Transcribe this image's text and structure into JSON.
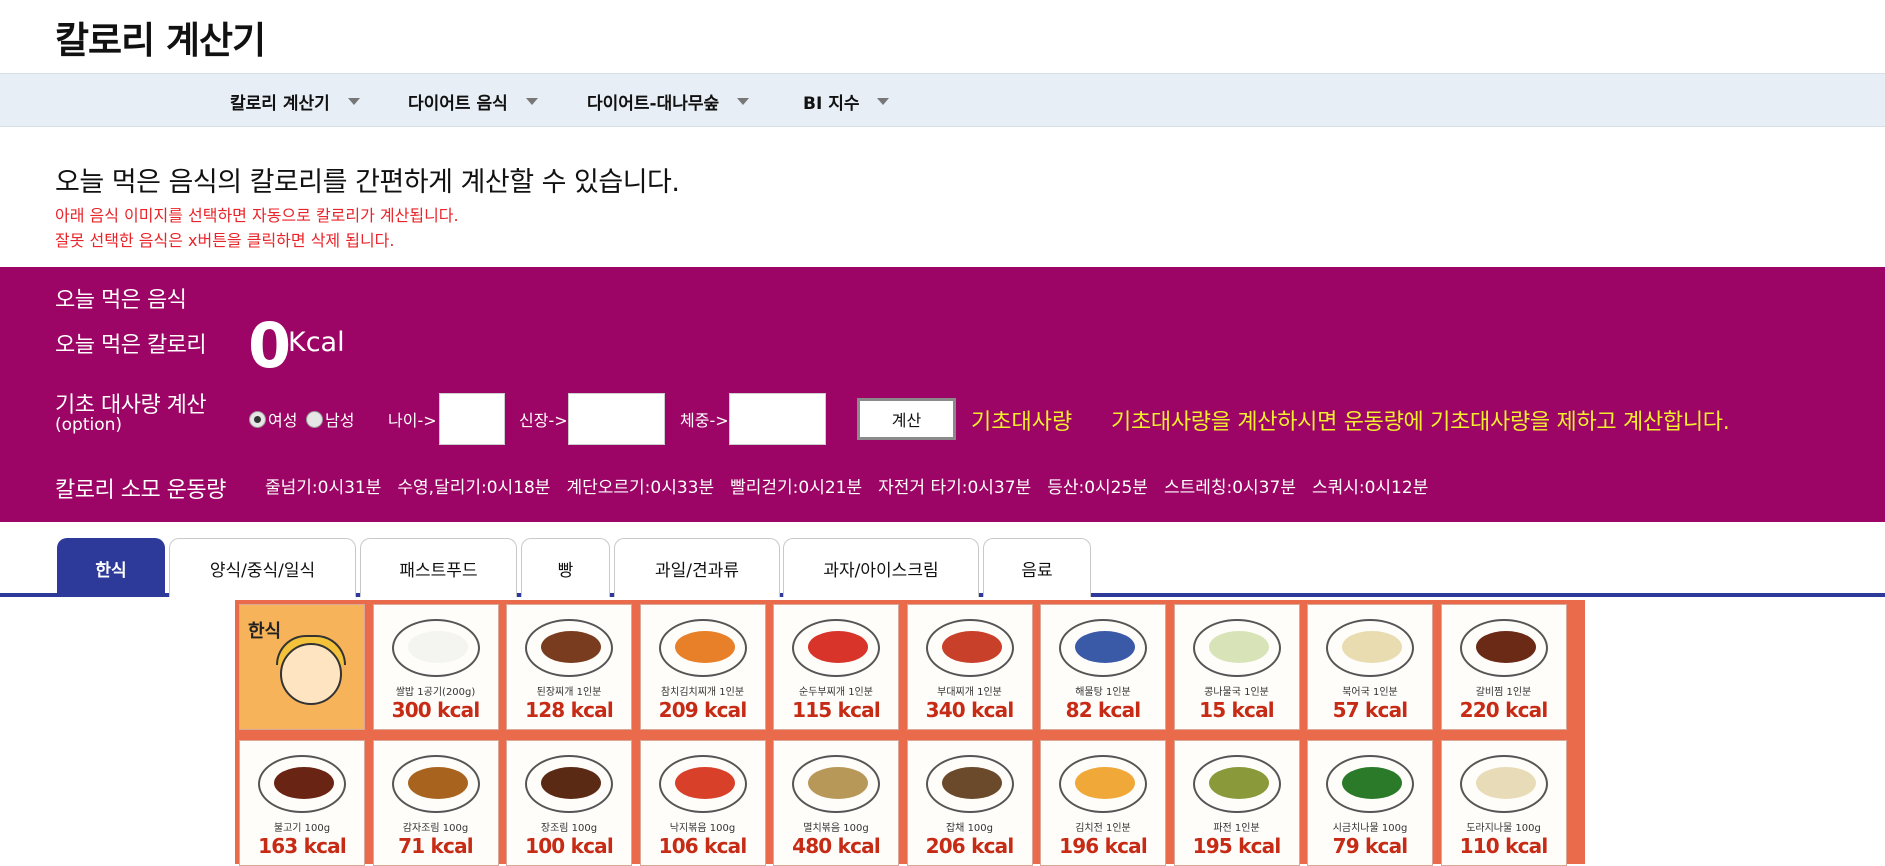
{
  "site": {
    "title": "칼로리 계산기"
  },
  "nav": {
    "items": [
      {
        "label": "칼로리 계산기"
      },
      {
        "label": "다이어트 음식"
      },
      {
        "label": "다이어트-대나무숲"
      },
      {
        "label": "BI 지수"
      }
    ]
  },
  "intro": {
    "main": "오늘 먹은 음식의 칼로리를 간편하게 계산할 수 있습니다.",
    "note1": "아래 음식 이미지를 선택하면 자동으로 칼로리가 계산됩니다.",
    "note2": "잘못 선택한 음식은 x버튼을 클릭하면 삭제 됩니다."
  },
  "panel": {
    "today_food_label": "오늘 먹은 음식",
    "today_kcal_label": "오늘 먹은 칼로리",
    "kcal_value": "0",
    "kcal_unit": "Kcal",
    "bmr_calc_label": "기초 대사량 계산",
    "bmr_option": "(option)",
    "gender_female": "여성",
    "gender_male": "남성",
    "selected_gender": "여성",
    "age_label": "나이->",
    "height_label": "신장->",
    "weight_label": "체중->",
    "calc_button": "계산",
    "bmr_result_label": "기초대사량",
    "bmr_note": "기초대사량을 계산하시면 운동량에 기초대사량을 제하고 계산합니다.",
    "exercise_label": "칼로리 소모 운동량",
    "exercises": [
      "줄넘기:0시31분",
      "수영,달리기:0시18분",
      "계단오르기:0시33분",
      "빨리걷기:0시21분",
      "자전거 타기:0시37분",
      "등산:0시25분",
      "스트레칭:0시37분",
      "스쿼시:0시12분"
    ]
  },
  "tabs": [
    {
      "label": "한식",
      "active": true
    },
    {
      "label": "양식/중식/일식",
      "active": false
    },
    {
      "label": "패스트푸드",
      "active": false
    },
    {
      "label": "빵",
      "active": false
    },
    {
      "label": "과일/견과류",
      "active": false
    },
    {
      "label": "과자/아이스크림",
      "active": false
    },
    {
      "label": "음료",
      "active": false
    }
  ],
  "food_grid": {
    "header_label": "한식",
    "row1": [
      {
        "name": "쌀밥 1공기(200g)",
        "kcal": "300 kcal",
        "color": "#f4f4f0"
      },
      {
        "name": "된장찌개 1인분",
        "kcal": "128 kcal",
        "color": "#7a3c1e"
      },
      {
        "name": "참치김치찌개 1인분",
        "kcal": "209 kcal",
        "color": "#e8802a"
      },
      {
        "name": "순두부찌개 1인분",
        "kcal": "115 kcal",
        "color": "#d8342a"
      },
      {
        "name": "부대찌개 1인분",
        "kcal": "340 kcal",
        "color": "#c8402a"
      },
      {
        "name": "해물탕 1인분",
        "kcal": "82 kcal",
        "color": "#3a5aa8"
      },
      {
        "name": "콩나물국 1인분",
        "kcal": "15 kcal",
        "color": "#d8e4b8"
      },
      {
        "name": "북어국 1인분",
        "kcal": "57 kcal",
        "color": "#e8dcb0"
      },
      {
        "name": "갈비찜 1인분",
        "kcal": "220 kcal",
        "color": "#6a2a16"
      }
    ],
    "row2": [
      {
        "name": "불고기 100g",
        "kcal": "163 kcal",
        "color": "#6a2414"
      },
      {
        "name": "감자조림 100g",
        "kcal": "71 kcal",
        "color": "#a8641e"
      },
      {
        "name": "장조림 100g",
        "kcal": "100 kcal",
        "color": "#5a2a14"
      },
      {
        "name": "낙지볶음 100g",
        "kcal": "106 kcal",
        "color": "#d8402a"
      },
      {
        "name": "멸치볶음 100g",
        "kcal": "480 kcal",
        "color": "#b89858"
      },
      {
        "name": "잡채 100g",
        "kcal": "206 kcal",
        "color": "#6a4a2a"
      },
      {
        "name": "김치전 1인분",
        "kcal": "196 kcal",
        "color": "#f0a838"
      },
      {
        "name": "파전 1인분",
        "kcal": "195 kcal",
        "color": "#8a9a3a"
      },
      {
        "name": "시금치나물 100g",
        "kcal": "79 kcal",
        "color": "#2a7a2a"
      },
      {
        "name": "도라지나물 100g",
        "kcal": "110 kcal",
        "color": "#e8dcb8"
      }
    ]
  },
  "colors": {
    "panel_bg": "#9c0566",
    "accent_yellow": "#f1ee2c",
    "tab_active": "#2e3a9a",
    "note_red": "#e8242a",
    "grid_bg": "#ea6a4c"
  }
}
